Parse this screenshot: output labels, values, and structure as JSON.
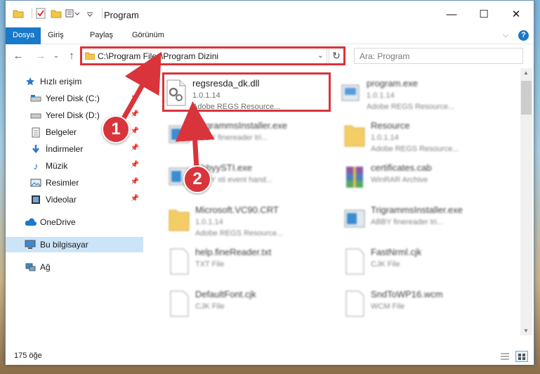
{
  "window": {
    "title": "Program",
    "controls": {
      "minimize": "—",
      "maximize": "☐",
      "close": "✕"
    }
  },
  "ribbon": {
    "tabs": [
      {
        "label": "Dosya",
        "active": true
      },
      {
        "label": "Giriş",
        "active": false
      },
      {
        "label": "Paylaş",
        "active": false
      },
      {
        "label": "Görünüm",
        "active": false
      }
    ],
    "help": "?"
  },
  "address": {
    "path": "C:\\Program Files\\Program Dizini",
    "search_placeholder": "Ara: Program"
  },
  "nav": {
    "items": [
      {
        "label": "Hızlı erişim",
        "icon": "star-icon",
        "pinned": false
      },
      {
        "label": "Yerel Disk (C:)",
        "icon": "drive-icon",
        "pinned": true
      },
      {
        "label": "Yerel Disk (D:)",
        "icon": "drive-icon",
        "pinned": true
      },
      {
        "label": "Belgeler",
        "icon": "documents-icon",
        "pinned": true
      },
      {
        "label": "İndirmeler",
        "icon": "download-icon",
        "pinned": true
      },
      {
        "label": "Müzik",
        "icon": "music-icon",
        "pinned": true
      },
      {
        "label": "Resimler",
        "icon": "pictures-icon",
        "pinned": true
      },
      {
        "label": "Videolar",
        "icon": "videos-icon",
        "pinned": true
      },
      {
        "label": "OneDrive",
        "icon": "cloud-icon",
        "pinned": false
      },
      {
        "label": "Bu bilgisayar",
        "icon": "computer-icon",
        "pinned": false,
        "selected": true
      },
      {
        "label": "Ağ",
        "icon": "network-icon",
        "pinned": false
      }
    ]
  },
  "files": [
    {
      "name": "regsresda_dk.dll",
      "line1": "1.0.1.14",
      "line2": "Adobe REGS Resource...",
      "icon": "dll-gear-icon",
      "highlighted": true
    },
    {
      "name": "program.exe",
      "line1": "1.0.1.14",
      "line2": "Adobe REGS Resource...",
      "icon": "exe-icon"
    },
    {
      "name": "TrigrammsInstaller.exe",
      "line1": "ABBY finereader tri...",
      "line2": "",
      "icon": "installer-icon"
    },
    {
      "name": "Resource",
      "line1": "1.0.1.14",
      "line2": "Adobe REGS Resource...",
      "icon": "folder-icon"
    },
    {
      "name": "AbbyySTI.exe",
      "line1": "ABBY sti event hand...",
      "line2": "",
      "icon": "installer-icon"
    },
    {
      "name": "certificates.cab",
      "line1": "WinRAR Archive",
      "line2": "",
      "icon": "archive-icon"
    },
    {
      "name": "Microsoft.VC90.CRT",
      "line1": "1.0.1.14",
      "line2": "Adobe REGS Resource...",
      "icon": "folder-icon"
    },
    {
      "name": "TrigrammsInstaller.exe",
      "line1": "ABBY finereader tri...",
      "line2": "",
      "icon": "installer-icon"
    },
    {
      "name": "help.fineReader.txt",
      "line1": "TXT File",
      "line2": "",
      "icon": "file-icon"
    },
    {
      "name": "FastNrml.cjk",
      "line1": "CJK File",
      "line2": "",
      "icon": "file-icon"
    },
    {
      "name": "DefaultFont.cjk",
      "line1": "CJK File",
      "line2": "",
      "icon": "file-icon"
    },
    {
      "name": "SndToWP16.wcm",
      "line1": "WCM File",
      "line2": "",
      "icon": "file-icon"
    }
  ],
  "status": {
    "count": "175 öğe"
  },
  "callouts": [
    "1",
    "2"
  ],
  "colors": {
    "accent": "#1979ca",
    "highlight": "#d9343b",
    "selection": "#cce4f7"
  }
}
